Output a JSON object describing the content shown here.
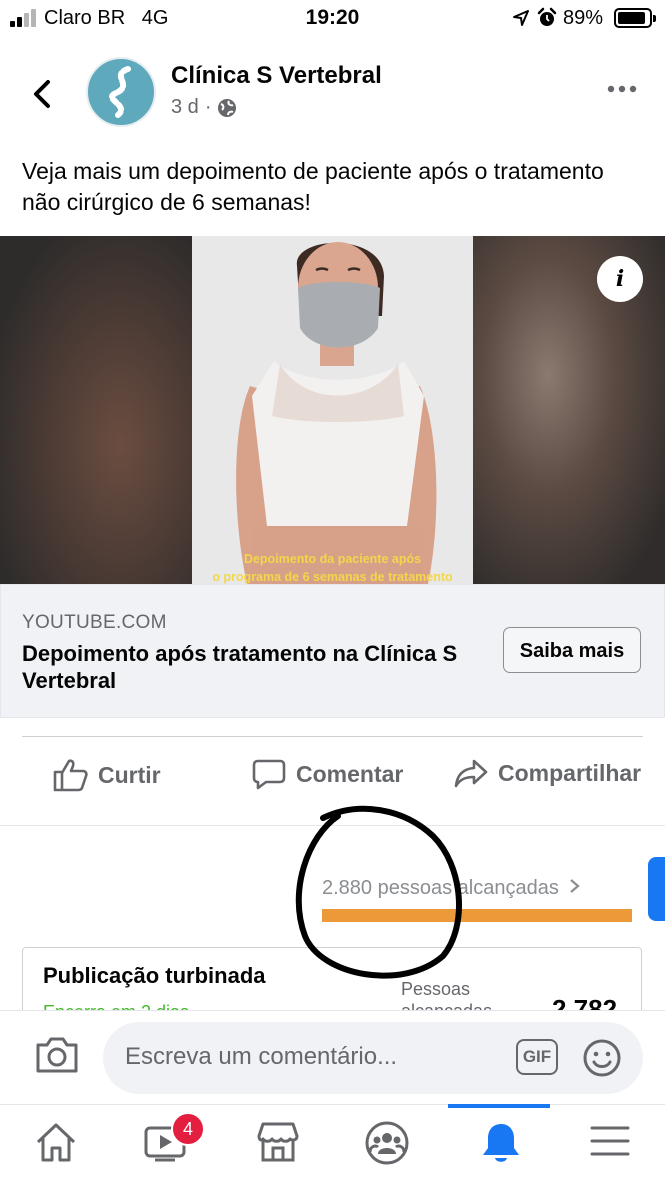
{
  "status_bar": {
    "carrier": "Claro BR   4G",
    "time": "19:20",
    "battery": "89%",
    "battery_level": 0.89
  },
  "post": {
    "page_name": "Clínica S Vertebral",
    "time_ago": "3 d",
    "separator": "·",
    "privacy_icon": "globe-icon",
    "text": "Veja mais um depoimento de paciente após o tratamento não cirúrgico de 6 semanas!"
  },
  "media": {
    "caption_line1": "Depoimento da paciente após",
    "caption_line2": "o programa de 6 semanas de tratamento",
    "info_glyph": "i"
  },
  "link_preview": {
    "domain": "YOUTUBE.COM",
    "title": "Depoimento após tratamento na Clínica S Vertebral",
    "cta": "Saiba mais"
  },
  "actions": {
    "like": "Curtir",
    "comment": "Comentar",
    "share": "Compartilhar"
  },
  "insights": {
    "reach_text": "2.880 pessoas alcançadas",
    "boost_title": "Publicação turbinada",
    "boost_status": "Encerra em 2 dias",
    "boost_reach_label": "Pessoas alcançadas",
    "boost_reach_value": "2.782"
  },
  "comment_bar": {
    "placeholder": "Escreva um comentário...",
    "gif_label": "GIF"
  },
  "tab_bar": {
    "watch_badge": "4",
    "active_tab": "notifications",
    "tabs": [
      "home",
      "watch",
      "marketplace",
      "groups",
      "notifications",
      "menu"
    ]
  },
  "colors": {
    "accent": "#1877f2",
    "reach_bar": "#ec9a39",
    "badge": "#e41e3f",
    "boost_status": "#42b72a",
    "text_secondary": "#65676b"
  }
}
